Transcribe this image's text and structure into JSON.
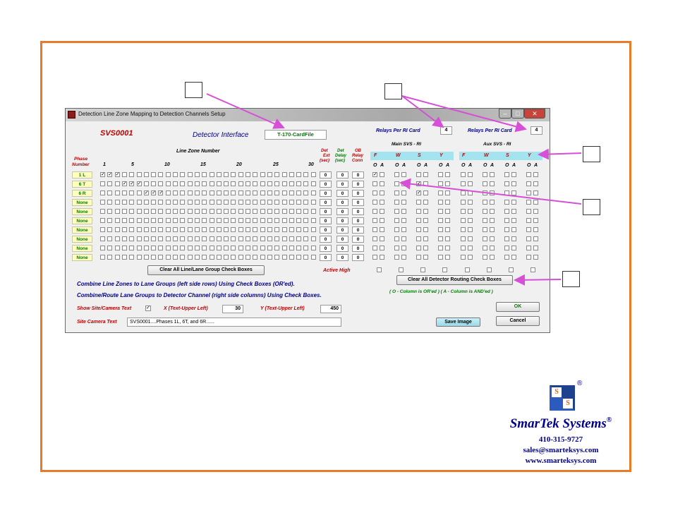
{
  "window": {
    "title": "Detection Line Zone Mapping to Detection Channels Setup"
  },
  "header": {
    "site_id": "SVS0001",
    "detector_interface_label": "Detector Interface",
    "detector_interface_value": "T-170-CardFile",
    "relays_label_1": "Relays Per RI Card",
    "relays_value_1": "4",
    "relays_label_2": "Relays Per RI Card",
    "relays_value_2": "4"
  },
  "grid": {
    "phase_header": [
      "Phase",
      "Number"
    ],
    "line_zone_label": "Line Zone Number",
    "zone_ticks": [
      "1",
      "5",
      "10",
      "15",
      "20",
      "25",
      "30"
    ],
    "det_ext_header": [
      "Det",
      "Ext",
      "(sec)"
    ],
    "det_delay_header": [
      "Det",
      "Delay",
      "(sec)"
    ],
    "ob_relay_header": [
      "OB",
      "Relay",
      "Conn"
    ],
    "rows": [
      {
        "phase": "1 L",
        "ext": "0",
        "delay": "0",
        "ob": "0",
        "zones": [
          1,
          2,
          3
        ],
        "main": [
          0
        ]
      },
      {
        "phase": "6 T",
        "ext": "0",
        "delay": "0",
        "ob": "0",
        "zones": [
          4,
          5,
          6
        ],
        "main": [
          2
        ]
      },
      {
        "phase": "6 R",
        "ext": "0",
        "delay": "0",
        "ob": "0",
        "zones": [
          7,
          8,
          9
        ],
        "main": [
          2
        ]
      },
      {
        "phase": "None",
        "ext": "0",
        "delay": "0",
        "ob": "0",
        "zones": [],
        "main": []
      },
      {
        "phase": "None",
        "ext": "0",
        "delay": "0",
        "ob": "0",
        "zones": [],
        "main": []
      },
      {
        "phase": "None",
        "ext": "0",
        "delay": "0",
        "ob": "0",
        "zones": [],
        "main": []
      },
      {
        "phase": "None",
        "ext": "0",
        "delay": "0",
        "ob": "0",
        "zones": [],
        "main": []
      },
      {
        "phase": "None",
        "ext": "0",
        "delay": "0",
        "ob": "0",
        "zones": [],
        "main": []
      },
      {
        "phase": "None",
        "ext": "0",
        "delay": "0",
        "ob": "0",
        "zones": [],
        "main": []
      },
      {
        "phase": "None",
        "ext": "0",
        "delay": "0",
        "ob": "0",
        "zones": [],
        "main": []
      }
    ]
  },
  "routing": {
    "main_title": "Main SVS - RI",
    "aux_title": "Aux SVS - RI",
    "cols": [
      "F",
      "W",
      "S",
      "Y"
    ],
    "oa": [
      "O",
      "A"
    ],
    "active_high_label": "Active High",
    "legend": "( O - Column is OR'ed )  ( A - Column is AND'ed )"
  },
  "buttons": {
    "clear_line": "Clear All Line/Lane Group Check Boxes",
    "clear_routing": "Clear All Detector Routing Check Boxes",
    "ok": "OK",
    "cancel": "Cancel",
    "save_image": "Save Image"
  },
  "instructions": {
    "line1": "Combine Line Zones to Lane Groups (left side rows) Using Check Boxes (OR'ed).",
    "line2": "Combine/Route Lane Groups to Detector Channel (right side columns) Using Check Boxes."
  },
  "text_options": {
    "show_label": "Show Site/Camera Text",
    "show_checked": "✓",
    "x_label": "X (Text-Upper Left)",
    "x_value": "30",
    "y_label": "Y (Text-Upper Left)",
    "y_value": "450",
    "camera_text_label": "Site Camera Text",
    "camera_text_value": "SVS0001....Phases 1L, 6T, and 6R......"
  },
  "company": {
    "name": "SmarTek Systems",
    "registered": "®",
    "logo_letter": "S",
    "phone": "410-315-9727",
    "email": "sales@smarteksys.com",
    "web": "www.smarteksys.com"
  },
  "colors": {
    "frame": "#e87a2a",
    "arrow": "#d64fd6",
    "header_band": "#a4e4f0",
    "phase_bg": "#ffffc0"
  }
}
